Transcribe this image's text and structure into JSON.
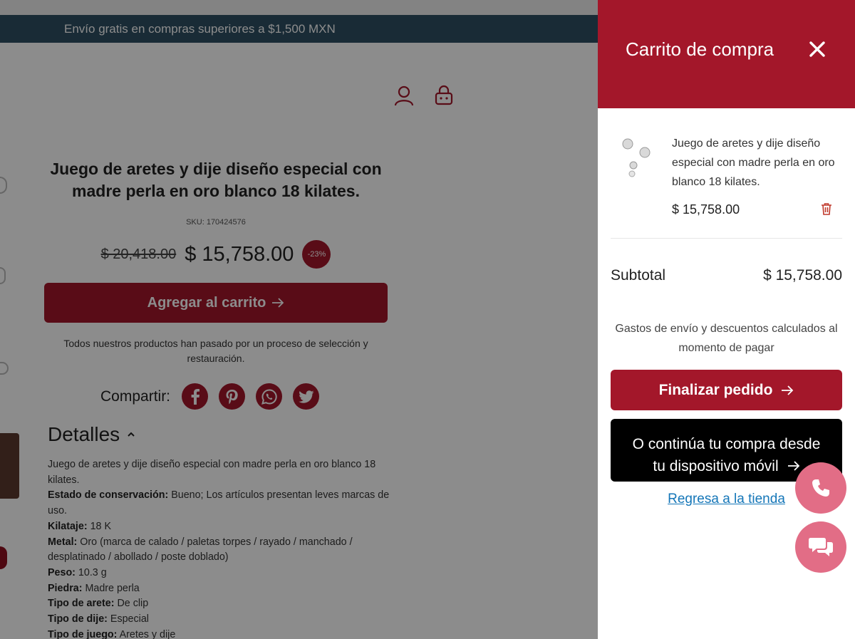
{
  "promo": {
    "text": "Envío gratis en compras superiores a $1,500 MXN"
  },
  "header": {
    "icons": [
      "user-icon",
      "shopping-basket-icon"
    ]
  },
  "product": {
    "title": "Juego de aretes y dije diseño especial con madre perla en oro blanco 18 kilates.",
    "sku": "SKU: 170424576",
    "old_price": "$ 20,418.00",
    "price": "$ 15,758.00",
    "discount": "-23%",
    "add_to_cart_label": "Agregar al carrito",
    "note": "Todos nuestros productos han pasado por un proceso de selección y restauración.",
    "share_label": "Compartir:",
    "share_icons": [
      "facebook-icon",
      "pinterest-icon",
      "whatsapp-icon",
      "twitter-icon"
    ],
    "details_title": "Detalles",
    "details_intro": "Juego de aretes y dije diseño especial con madre perla en oro blanco 18 kilates.",
    "details": [
      {
        "label": "Estado de conservación:",
        "value": "Bueno; Los artículos presentan leves marcas de uso."
      },
      {
        "label": "Kilataje:",
        "value": "18 K"
      },
      {
        "label": "Metal:",
        "value": "Oro (marca de calado / paletas torpes / rayado / manchado / desplatinado / abollado / poste doblado)"
      },
      {
        "label": "Peso:",
        "value": "10.3 g"
      },
      {
        "label": "Piedra:",
        "value": "Madre perla"
      },
      {
        "label": "Tipo de arete:",
        "value": "De clip"
      },
      {
        "label": "Tipo de dije:",
        "value": "Especial"
      },
      {
        "label": "Tipo de juego:",
        "value": "Aretes y dije"
      }
    ]
  },
  "cart": {
    "title": "Carrito de compra",
    "close_icon": "close-icon",
    "item": {
      "name": "Juego de aretes y dije diseño especial con madre perla en oro blanco 18 kilates.",
      "price": "$ 15,758.00"
    },
    "subtotal_label": "Subtotal",
    "subtotal_value": "$ 15,758.00",
    "shipping_note": "Gastos de envío y descuentos calculados al momento de pagar",
    "checkout_label": "Finalizar pedido",
    "mobile_line1": "O continúa tu compra desde",
    "mobile_line2": "tu dispositivo móvil",
    "back_link": "Regresa a la tienda"
  },
  "floating": {
    "phone_icon": "phone-icon",
    "chat_icon": "chat-icon"
  },
  "colors": {
    "brand": "#a3172a",
    "promo_bar": "#2e4f63",
    "fab": "#e26d86",
    "link": "#1476b8"
  }
}
